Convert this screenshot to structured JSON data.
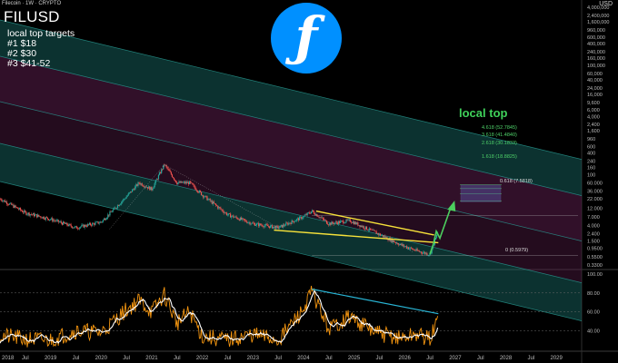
{
  "header": {
    "source_line": "Filecoin · 1W · CRYPTO",
    "symbol": "FILUSD",
    "notes": [
      "local top targets",
      "#1 $18",
      "#2 $30",
      "#3 $41-52"
    ],
    "currency": "USD",
    "logo_icon": "filecoin-logo-icon",
    "annotation": "local top"
  },
  "colors": {
    "background": "#000000",
    "up_candle": "#26a69a",
    "down_candle": "#ef5350",
    "channel_teal": "#1b6f6a",
    "channel_purple": "#5a1d4a",
    "trendline": "#f7e23a",
    "arrow": "#4ccf5e",
    "rsi_line": "#f2940f",
    "rsi_ma": "#ffffff",
    "divergence": "#29b6d6"
  },
  "fib_labels": [
    "4.618 (52.7845)",
    "3.618 (41.4840)",
    "2.618 (30.1833)",
    "1.618 (18.8825)",
    "0.618 (7.5818)",
    "0 (0.5979)"
  ],
  "chart_data": [
    {
      "type": "line",
      "title": "FILUSD",
      "scale": "log",
      "ylabel": "USD",
      "ylim": [
        0.3,
        4000000
      ],
      "x_ticks": [
        "2018",
        "Jul",
        "2019",
        "Jul",
        "2020",
        "Jul",
        "2021",
        "Jul",
        "2022",
        "Jul",
        "2023",
        "Jul",
        "2024",
        "Jul",
        "2025",
        "Jul",
        "2026",
        "Jul",
        "2027",
        "Jul",
        "2028",
        "Jul",
        "2029"
      ],
      "y_ticks": [
        "4,000,000",
        "2,400,000",
        "1,600,000",
        "960,000",
        "600,000",
        "400,000",
        "240,000",
        "160,000",
        "100,000",
        "60,000",
        "40,000",
        "24,000",
        "16,000",
        "9,600",
        "6,000",
        "4,000",
        "2,400",
        "1,600",
        "960",
        "600",
        "400",
        "240",
        "160",
        "100",
        "60.000",
        "36.000",
        "22.000",
        "12.000",
        "7.000",
        "4.000",
        "2.400",
        "1.500",
        "0.9500",
        "0.5500",
        "0.3300"
      ],
      "series": [
        {
          "x": [
            "2018-01",
            "2018-07",
            "2019-01",
            "2019-07",
            "2020-01",
            "2020-07",
            "2020-10",
            "2021-01",
            "2021-04",
            "2021-07",
            "2021-10",
            "2022-01",
            "2022-07",
            "2023-01",
            "2023-07",
            "2024-01",
            "2024-03",
            "2024-07",
            "2024-12",
            "2025-06",
            "2025-12",
            "2026-04",
            "2026-07",
            "2026-09"
          ],
          "y": [
            22,
            9,
            6,
            3.5,
            5,
            25,
            60,
            40,
            190,
            60,
            60,
            28,
            8,
            4.5,
            3.5,
            7,
            10,
            4.5,
            5.5,
            2.6,
            1.2,
            0.8,
            0.65,
            2.8
          ]
        }
      ],
      "fib_levels": [
        {
          "label": "4.618",
          "value": 52.7845
        },
        {
          "label": "3.618",
          "value": 41.484
        },
        {
          "label": "2.618",
          "value": 30.1833
        },
        {
          "label": "1.618",
          "value": 18.8825
        },
        {
          "label": "0.618",
          "value": 7.5818
        },
        {
          "label": "0",
          "value": 0.5979
        }
      ],
      "targets": [
        18,
        30,
        41,
        52
      ]
    },
    {
      "type": "line",
      "title": "",
      "ylim": [
        20,
        100
      ],
      "y_ticks": [
        "100.00",
        "80.00",
        "60.00",
        "40.00"
      ],
      "series": [
        {
          "x": [
            "2018-01",
            "2018-07",
            "2019-01",
            "2019-07",
            "2020-01",
            "2020-07",
            "2020-10",
            "2021-01",
            "2021-04",
            "2021-07",
            "2021-10",
            "2022-01",
            "2022-07",
            "2023-01",
            "2023-07",
            "2024-01",
            "2024-03",
            "2024-07",
            "2024-12",
            "2025-06",
            "2025-12",
            "2026-04",
            "2026-07",
            "2026-09"
          ],
          "y": [
            35,
            31,
            30,
            40,
            38,
            62,
            72,
            60,
            78,
            48,
            60,
            34,
            30,
            36,
            30,
            62,
            82,
            42,
            55,
            38,
            32,
            36,
            31,
            52
          ]
        }
      ]
    }
  ]
}
